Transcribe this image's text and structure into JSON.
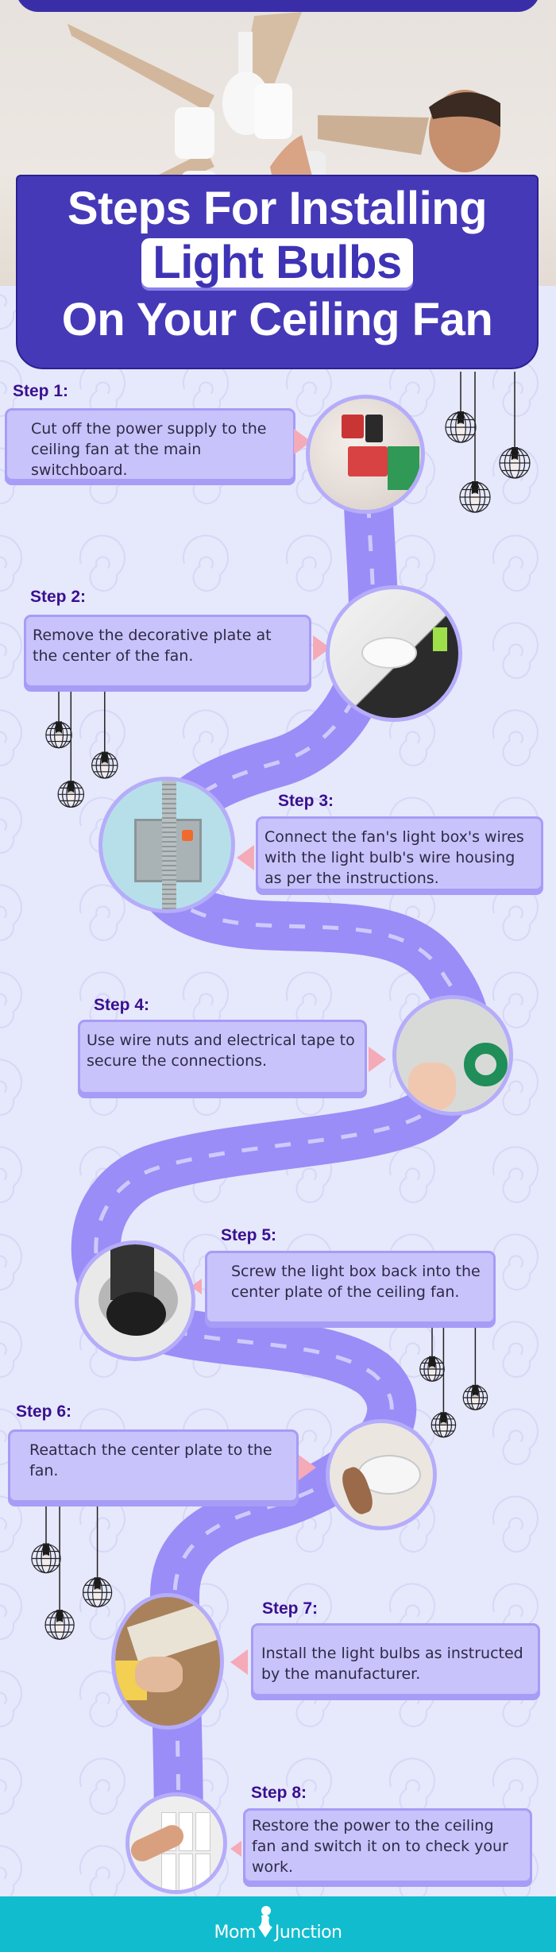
{
  "title": {
    "line1": "Steps For Installing",
    "highlight": "Light Bulbs",
    "line3": "On Your Ceiling Fan"
  },
  "hero": {
    "image": "man-replacing-ceiling-fan-light-cover-photo"
  },
  "steps": [
    {
      "label": "Step 1:",
      "text": "Cut off the power supply to the ceiling fan at the main switchboard.",
      "image": "main-switch-breaker-photo"
    },
    {
      "label": "Step 2:",
      "text": "Remove the decorative plate at the center of the fan.",
      "image": "removing-fan-plate-photo"
    },
    {
      "label": "Step 3:",
      "text": "Connect the fan's light box's wires with the light bulb's wire housing as per the instructions.",
      "image": "junction-box-wires-photo"
    },
    {
      "label": "Step 4:",
      "text": "Use wire nuts and electrical tape to secure the connections.",
      "image": "taping-wires-photo"
    },
    {
      "label": "Step 5:",
      "text": "Screw the light box back into the center plate of the ceiling fan.",
      "image": "screwing-light-box-photo"
    },
    {
      "label": "Step 6:",
      "text": "Reattach the center plate to the fan.",
      "image": "reattaching-plate-photo"
    },
    {
      "label": "Step 7:",
      "text": "Install the light bulbs as instructed by the manufacturer.",
      "image": "installing-bulbs-photo"
    },
    {
      "label": "Step 8:",
      "text": "Restore the power to the ceiling fan and switch it on to check your work.",
      "image": "light-switch-photo"
    }
  ],
  "footer": {
    "brand_left": "Mom",
    "brand_right": "Junction"
  },
  "colors": {
    "title_bg": "#4639b8",
    "road": "#9a8df7",
    "step_box": "#c9c3fb",
    "step_label": "#3a108f",
    "pointer": "#f5aab7",
    "footer": "#11bccf",
    "background": "#e6e8fc"
  }
}
